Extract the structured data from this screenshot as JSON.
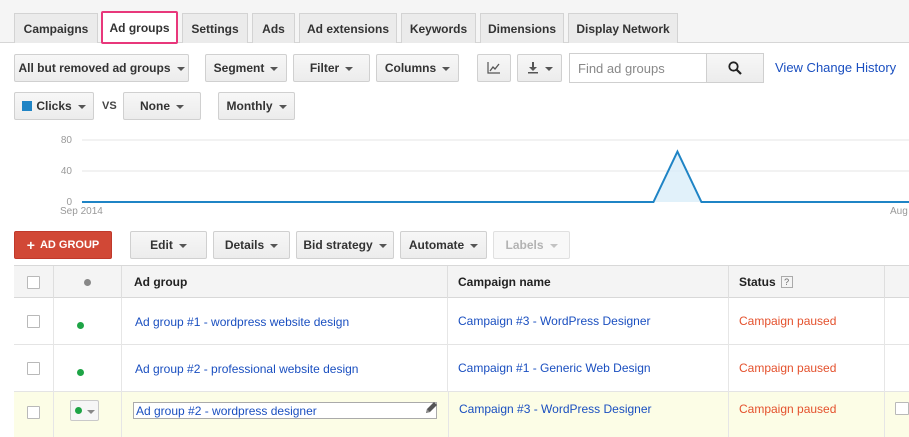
{
  "tabs": [
    {
      "label": "Campaigns",
      "active": false
    },
    {
      "label": "Ad groups",
      "active": true
    },
    {
      "label": "Settings",
      "active": false
    },
    {
      "label": "Ads",
      "active": false
    },
    {
      "label": "Ad extensions",
      "active": false
    },
    {
      "label": "Keywords",
      "active": false
    },
    {
      "label": "Dimensions",
      "active": false
    },
    {
      "label": "Display Network",
      "active": false
    }
  ],
  "toolbar": {
    "filter_status_label": "All but removed ad groups",
    "segment_label": "Segment",
    "filter_label": "Filter",
    "columns_label": "Columns",
    "chart_icon": "line-chart-icon",
    "download_icon": "download-icon",
    "search_placeholder": "Find ad groups",
    "search_icon": "search-icon",
    "view_change_history": "View Change History"
  },
  "chart_controls": {
    "metric1_label": "Clicks",
    "metric1_color": "#1f84c5",
    "vs_label": "VS",
    "metric2_label": "None",
    "period_label": "Monthly"
  },
  "chart_data": {
    "type": "area",
    "series": [
      {
        "name": "Clicks",
        "color": "#1f84c5"
      }
    ],
    "y_ticks": [
      "80",
      "40",
      "0"
    ],
    "ylim": [
      0,
      80
    ],
    "x_start_label": "Sep 2014",
    "x_end_label": "Aug",
    "grid": true,
    "peak": {
      "value": 65,
      "position_fraction": 0.72
    }
  },
  "actions": {
    "add_ad_group_label": "AD GROUP",
    "edit_label": "Edit",
    "details_label": "Details",
    "bid_strategy_label": "Bid strategy",
    "automate_label": "Automate",
    "labels_label": "Labels"
  },
  "table": {
    "headers": {
      "ad_group": "Ad group",
      "campaign": "Campaign name",
      "status": "Status",
      "status_help": "?"
    },
    "rows": [
      {
        "ad_group": "Ad group #1 - wordpress website design",
        "campaign": "Campaign #3 - WordPress Designer",
        "status": "Campaign paused"
      },
      {
        "ad_group": "Ad group #2 - professional website design",
        "campaign": "Campaign #1 - Generic Web Design",
        "status": "Campaign paused"
      },
      {
        "ad_group": "Ad group #2 - wordpress designer",
        "campaign": "Campaign #3 - WordPress Designer",
        "status": "Campaign paused"
      }
    ]
  }
}
